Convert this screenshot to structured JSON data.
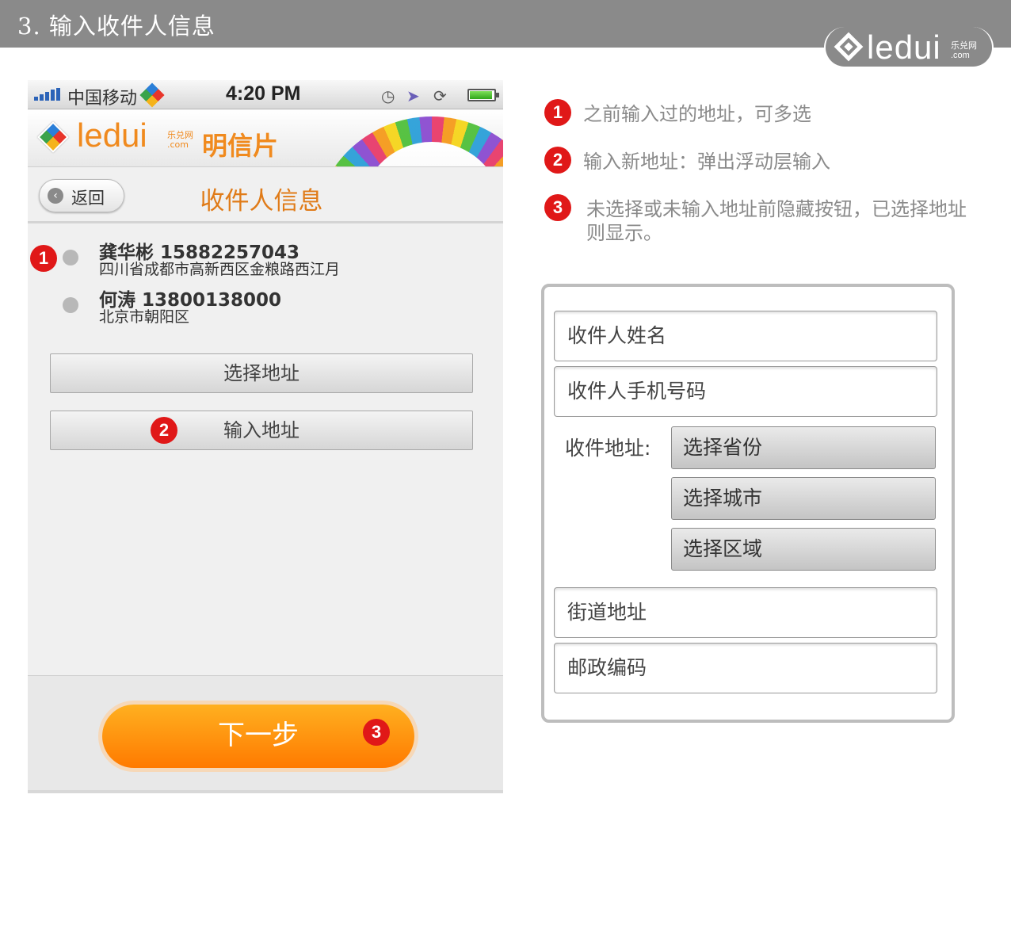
{
  "header": {
    "title": "3. 输入收件人信息",
    "brand": "ledui",
    "brand_sub_top": "乐兑网",
    "brand_sub_bottom": ".com"
  },
  "phone": {
    "status": {
      "carrier": "中国移动",
      "time": "4:20 PM"
    },
    "app": {
      "logo_text": "ledui",
      "logo_sub_top": "乐兑网",
      "logo_sub_bottom": ".com",
      "product": "明信片"
    },
    "nav": {
      "back_label": "返回",
      "title": "收件人信息"
    },
    "addresses": [
      {
        "name": "龚华彬 15882257043",
        "address": "四川省成都市高新西区金粮路西江月"
      },
      {
        "name": "何涛 13800138000",
        "address": "北京市朝阳区"
      }
    ],
    "buttons": {
      "select_address": "选择地址",
      "input_address": "输入地址",
      "next": "下一步"
    }
  },
  "badges": {
    "one": "1",
    "two": "2",
    "three": "3"
  },
  "notes": [
    "之前输入过的地址，可多选",
    "输入新地址：弹出浮动层输入",
    "未选择或未输入地址前隐藏按钮，已选择地址",
    "则显示。"
  ],
  "form": {
    "name_field": "收件人姓名",
    "phone_field": "收件人手机号码",
    "address_label": "收件地址:",
    "province": "选择省份",
    "city": "选择城市",
    "district": "选择区域",
    "street_field": "街道地址",
    "postcode_field": "邮政编码"
  },
  "colors": {
    "accent_orange": "#f08a1e",
    "badge_red": "#e01818",
    "banner_gray": "#8a8a8a"
  }
}
